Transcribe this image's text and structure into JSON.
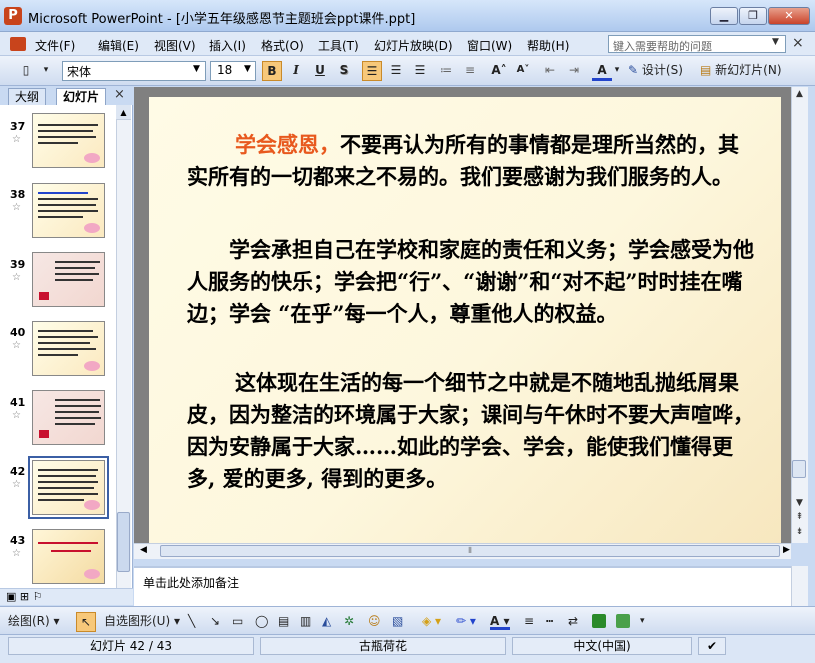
{
  "window": {
    "title": "Microsoft PowerPoint - [小学五年级感恩节主题班会ppt课件.ppt]",
    "app_icon": "P",
    "minimize": "▁",
    "maximize": "❐",
    "close": "✕"
  },
  "menu": {
    "items": [
      "文件(F)",
      "编辑(E)",
      "视图(V)",
      "插入(I)",
      "格式(O)",
      "工具(T)",
      "幻灯片放映(D)",
      "窗口(W)",
      "帮助(H)"
    ],
    "help_placeholder": "键入需要帮助的问题",
    "close_label": "×"
  },
  "toolbar": {
    "font": "宋体",
    "size": "18",
    "bold": "B",
    "italic": "I",
    "underline": "U",
    "shadow": "S",
    "font_color": "A",
    "grow": "A˄",
    "shrink": "A˅",
    "design": "设计(S)",
    "new_slide": "新幻灯片(N)"
  },
  "panel": {
    "tab_outline": "大纲",
    "tab_slides": "幻灯片",
    "close": "×",
    "slides": [
      {
        "num": "37",
        "star": "☆"
      },
      {
        "num": "38",
        "star": "☆"
      },
      {
        "num": "39",
        "star": "☆"
      },
      {
        "num": "40",
        "star": "☆"
      },
      {
        "num": "41",
        "star": "☆"
      },
      {
        "num": "42",
        "star": "☆"
      },
      {
        "num": "43",
        "star": "☆"
      }
    ],
    "selected_index": 5
  },
  "slide": {
    "p1_accent": "学会感恩，",
    "p1_rest": "不要再认为所有的事情都是理所当然的，其实所有的一切都来之不易的。我们要感谢为我们服务的人。",
    "p2": "学会承担自己在学校和家庭的责任和义务；学会感受为他人服务的快乐；学会把“行”、“谢谢”和“对不起”时时挂在嘴边；学会 “在乎”每一个人，尊重他人的权益。",
    "p3": "这体现在生活的每一个细节之中就是不随地乱抛纸屑果皮，因为整洁的环境属于大家；课间与午休时不要大声喧哗，因为安静属于大家……如此的学会、学会，能使我们懂得更多, 爱的更多, 得到的更多。"
  },
  "notes": {
    "placeholder": "单击此处添加备注"
  },
  "drawbar": {
    "draw": "绘图(R)",
    "autoshapes": "自选图形(U)"
  },
  "status": {
    "slide_indicator": "幻灯片 42 / 43",
    "design_template": "古瓶荷花",
    "language": "中文(中国)"
  },
  "colors": {
    "accent": "#e8591e",
    "selection": "#3b5fa5"
  }
}
